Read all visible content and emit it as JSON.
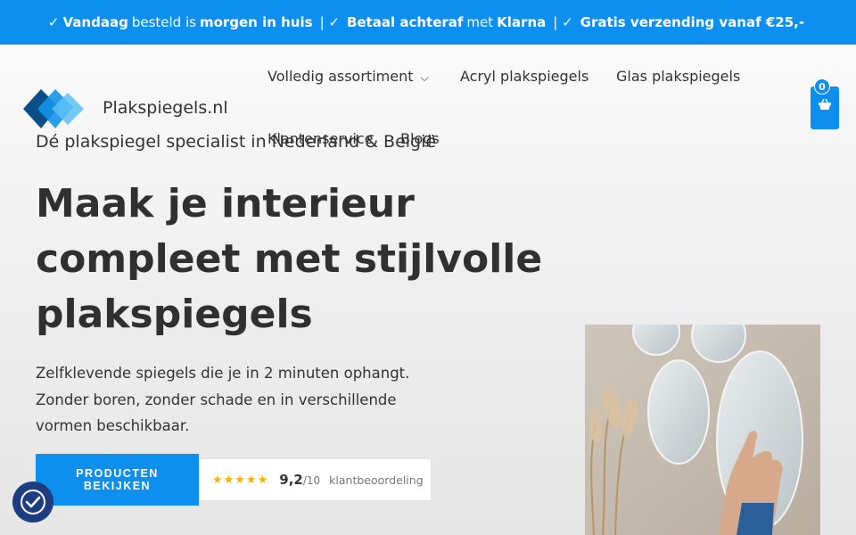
{
  "topbar": {
    "check1": "✓",
    "today": "Vandaag",
    "ordered": "besteld is",
    "tomorrow": "morgen in huis",
    "sep1": "| ✓",
    "pay_later": "Betaal achteraf",
    "with": "met",
    "klarna": "Klarna",
    "sep2": "| ✓",
    "free_shipping": "Gratis verzending vanaf €25,-"
  },
  "brand": {
    "name": "Plakspiegels.nl"
  },
  "nav": {
    "items": [
      {
        "label": "Volledig assortiment",
        "has_dropdown": true,
        "icon": "chevron-down-icon"
      },
      {
        "label": "Acryl plakspiegels"
      },
      {
        "label": "Glas plakspiegels"
      },
      {
        "label": "Klantenservice"
      },
      {
        "label": "Blogs"
      }
    ]
  },
  "cart": {
    "count": "0",
    "icon": "shopping-basket-icon"
  },
  "hero": {
    "tagline": "Dé plakspiegel specialist in Nederland & België",
    "headline": [
      "Maak je interieur",
      "compleet met stijlvolle",
      "plakspiegels"
    ],
    "description": [
      "Zelfklevende spiegels die je in 2 minuten ophangt.",
      "Zonder boren, zonder schade en in verschillende",
      "vormen beschikbaar."
    ],
    "cta_label_1": "PRODUCTEN",
    "cta_label_2": "BEKIJKEN"
  },
  "rating": {
    "stars": "★★★★★",
    "score": "9,2",
    "max": "/10",
    "label": "klantbeoordeling"
  },
  "colors": {
    "brand_blue": "#0d8ff0",
    "accessibility_navy": "#1c3d80",
    "star_gold": "#f5b301"
  },
  "accessibility": {
    "icon": "accessibility-icon"
  }
}
